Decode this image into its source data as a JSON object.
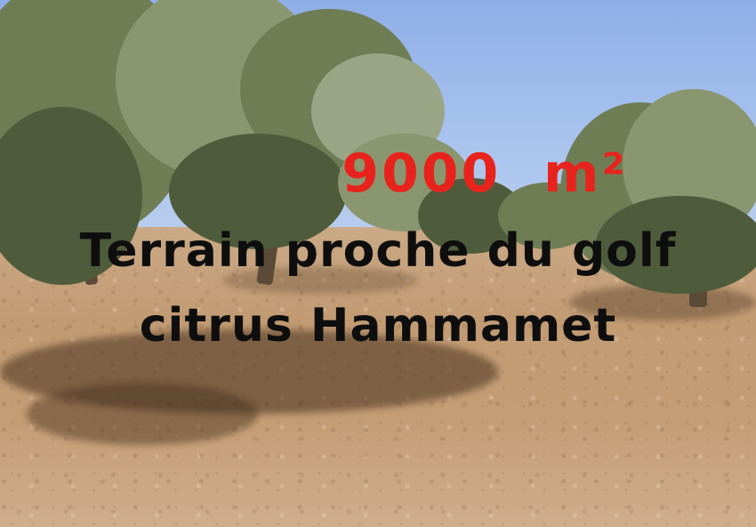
{
  "photo": {
    "subject": "olive grove on dry soil under blue sky"
  },
  "overlay": {
    "area_value": "9000",
    "area_unit": "m²",
    "headline_line1": "Terrain proche du golf",
    "headline_line2": "citrus Hammamet",
    "area_color": "#e8231d",
    "text_color": "#0e0e0e"
  }
}
